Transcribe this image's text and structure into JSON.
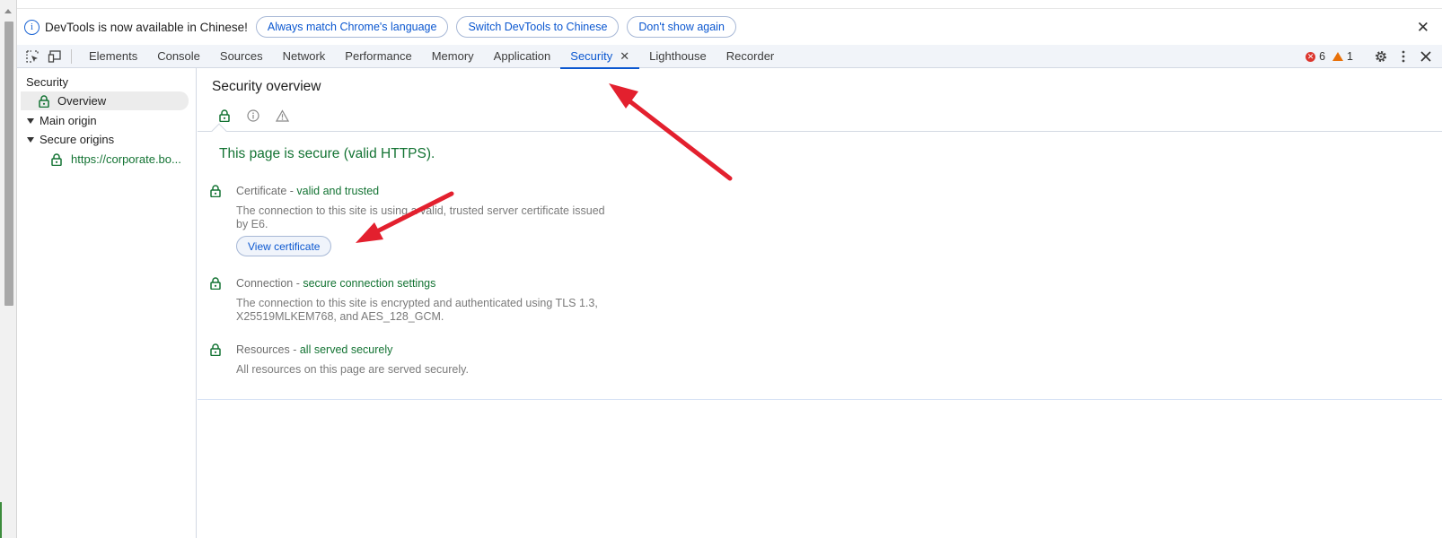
{
  "infobar": {
    "message": "DevTools is now available in Chinese!",
    "buttons": [
      "Always match Chrome's language",
      "Switch DevTools to Chinese",
      "Don't show again"
    ],
    "close_glyph": "✕"
  },
  "toolbar": {
    "tabs": [
      "Elements",
      "Console",
      "Sources",
      "Network",
      "Performance",
      "Memory",
      "Application",
      "Security",
      "Lighthouse",
      "Recorder"
    ],
    "active_tab": "Security",
    "close_glyph": "✕",
    "errors": "6",
    "warnings": "1"
  },
  "sidebar": {
    "section": "Security",
    "overview": "Overview",
    "main_origin": "Main origin",
    "secure_origins": "Secure origins",
    "origin_url": "https://corporate.bo..."
  },
  "main": {
    "title": "Security overview",
    "heading": "This page is secure (valid HTTPS).",
    "items": [
      {
        "label": "Certificate",
        "sep": " - ",
        "status": "valid and trusted",
        "desc": "The connection to this site is using a valid, trusted server certificate issued by E6."
      },
      {
        "label": "Connection",
        "sep": " - ",
        "status": "secure connection settings",
        "desc": "The connection to this site is encrypted and authenticated using TLS 1.3, X25519MLKEM768, and AES_128_GCM."
      },
      {
        "label": "Resources",
        "sep": " - ",
        "status": "all served securely",
        "desc": "All resources on this page are served securely."
      }
    ],
    "view_certificate": "View certificate"
  },
  "colors": {
    "accent": "#0b57d0",
    "secure_green": "#137333",
    "annotation_red": "#e3202e"
  }
}
